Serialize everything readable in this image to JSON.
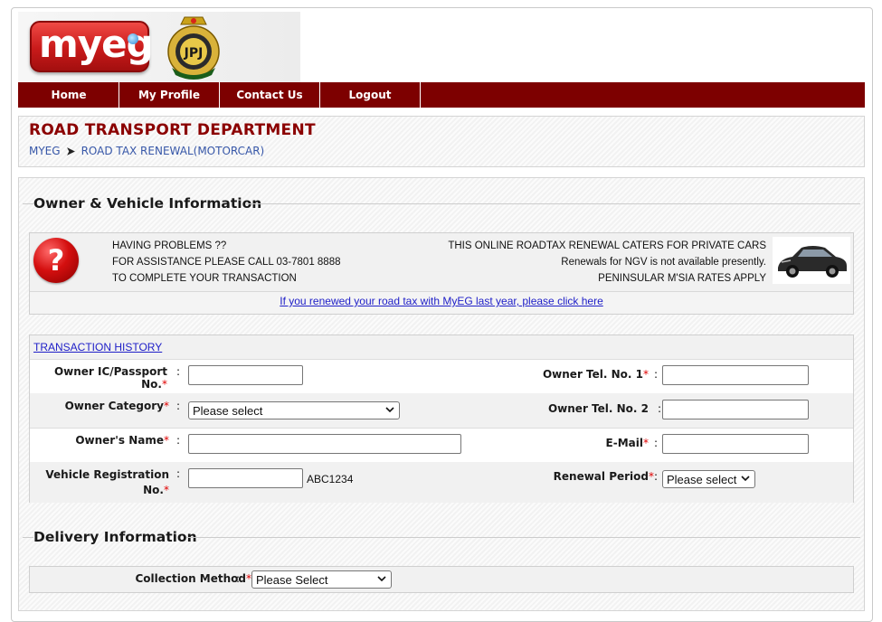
{
  "header": {
    "logo_text": "myeg",
    "emblem_text": "JPJ"
  },
  "nav": {
    "items": [
      {
        "label": "Home"
      },
      {
        "label": "My Profile"
      },
      {
        "label": "Contact Us"
      },
      {
        "label": "Logout"
      }
    ]
  },
  "page": {
    "title": "ROAD TRANSPORT DEPARTMENT",
    "breadcrumb": [
      {
        "label": "MYEG"
      },
      {
        "label": "ROAD TAX RENEWAL(MOTORCAR)"
      }
    ]
  },
  "owner_section": {
    "legend": "Owner & Vehicle Information",
    "help_lines": [
      "HAVING PROBLEMS ??",
      "FOR ASSISTANCE PLEASE CALL 03-7801 8888",
      "TO COMPLETE YOUR TRANSACTION"
    ],
    "promo_lines": [
      "THIS ONLINE ROADTAX RENEWAL CATERS FOR PRIVATE CARS",
      "Renewals for NGV is not available presently.",
      "PENINSULAR M'SIA RATES APPLY"
    ],
    "renew_link": "If you renewed your road tax with MyEG last year, please click here"
  },
  "form": {
    "history_link": "TRANSACTION HISTORY",
    "ic_label": "Owner IC/Passport No.",
    "ic_value": "",
    "category_label": "Owner Category",
    "category_value": "Please select",
    "name_label": "Owner's Name",
    "name_value": "",
    "vehicle_label_1": "Vehicle Registration",
    "vehicle_label_2": "No.",
    "vehicle_value": "",
    "vehicle_hint": "ABC1234",
    "tel1_label": "Owner Tel. No. 1",
    "tel1_value": "",
    "tel2_label": "Owner Tel. No. 2",
    "tel2_value": "",
    "email_label": "E-Mail",
    "email_value": "",
    "period_label": "Renewal Period",
    "period_value": "Please select",
    "required_mark": "*",
    "colon": ":"
  },
  "delivery": {
    "legend": "Delivery Information",
    "collection_label": "Collection Method",
    "collection_value": "Please Select"
  },
  "colors": {
    "nav_bg": "#7d0000",
    "title": "#8b0000",
    "breadcrumb": "#3757a8",
    "link": "#2020c8",
    "required": "#e00000"
  }
}
